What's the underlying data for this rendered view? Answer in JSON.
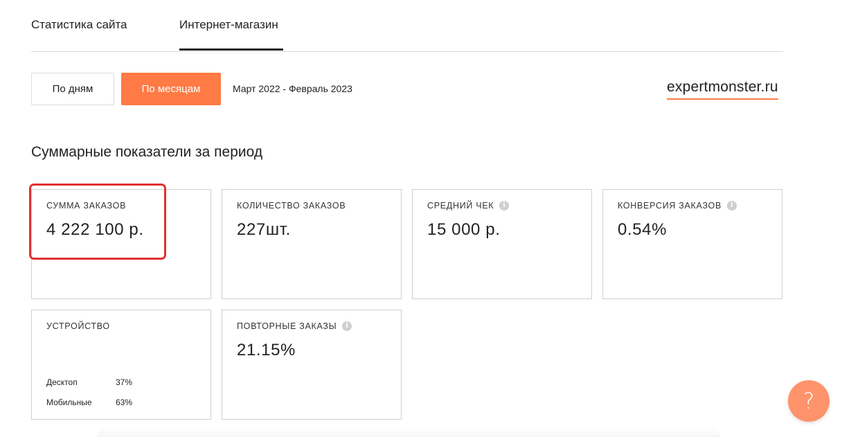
{
  "tabs": [
    {
      "label": "Статистика сайта"
    },
    {
      "label": "Интернет-магазин"
    }
  ],
  "toolbar": {
    "by_days_label": "По дням",
    "by_months_label": "По месяцам",
    "period": "Март 2022 - Февраль 2023"
  },
  "site": "expertmonster.ru",
  "section_title": "Суммарные показатели за период",
  "cards": [
    {
      "label": "СУММА ЗАКАЗОВ",
      "value": "4 222 100 р."
    },
    {
      "label": "КОЛИЧЕСТВО ЗАКАЗОВ",
      "value": "227шт."
    },
    {
      "label": "СРЕДНИЙ ЧЕК",
      "value": "15 000 р."
    },
    {
      "label": "КОНВЕРСИЯ ЗАКАЗОВ",
      "value": "0.54%"
    },
    {
      "label": "УСТРОЙСТВО"
    },
    {
      "label": "ПОВТОРНЫЕ ЗАКАЗЫ",
      "value": "21.15%"
    }
  ],
  "devices": [
    {
      "name": "Десктоп",
      "value": "37%"
    },
    {
      "name": "Мобильные",
      "value": "63%"
    }
  ],
  "info_icon_glyph": "i",
  "help_glyph": "?",
  "colors": {
    "accent": "#ff7a45",
    "highlight": "#e0322d",
    "help_button": "#ff936b"
  }
}
